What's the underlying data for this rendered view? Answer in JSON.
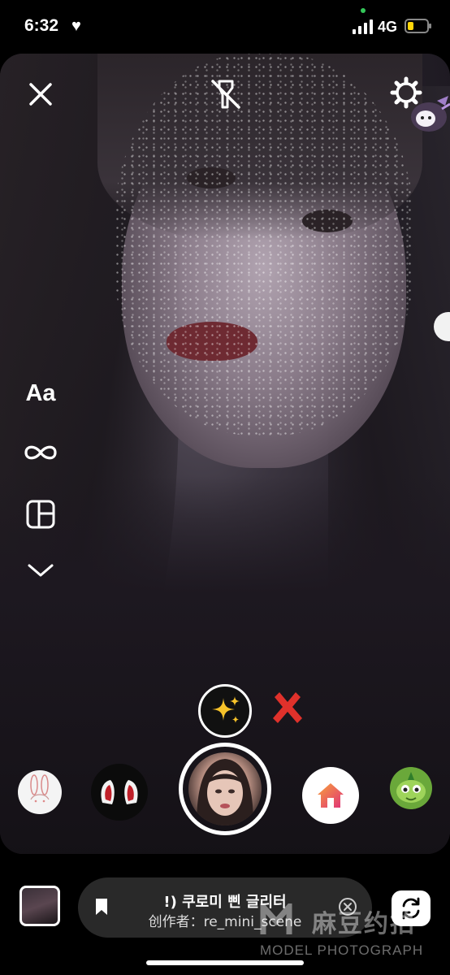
{
  "status_bar": {
    "time": "6:32",
    "network": "4G"
  },
  "camera": {
    "close_icon": "close-icon",
    "flash_icon": "flash-off-icon",
    "settings_icon": "settings-icon"
  },
  "tools": {
    "text_label": "Aa",
    "boomerang_icon": "infinity-icon",
    "layout_icon": "layout-icon",
    "more_icon": "chevron-down-icon"
  },
  "effect_tray": {
    "items": [
      "sparkle-effect",
      "remove-effect",
      "bunny-effect",
      "ears-effect",
      "capture",
      "home-effect",
      "dino-effect"
    ]
  },
  "effect_pill": {
    "name": "!) 쿠로미 삔 글리터",
    "creator": "创作者：re_mini_scene"
  },
  "watermark": {
    "main": "麻豆约拍",
    "sub": "MODEL PHOTOGRAPH"
  },
  "colors": {
    "accent_green": "#34c759",
    "battery_yellow": "#ffd60a",
    "remove_red": "#e0312b",
    "home_orange": "#f26b2a"
  }
}
